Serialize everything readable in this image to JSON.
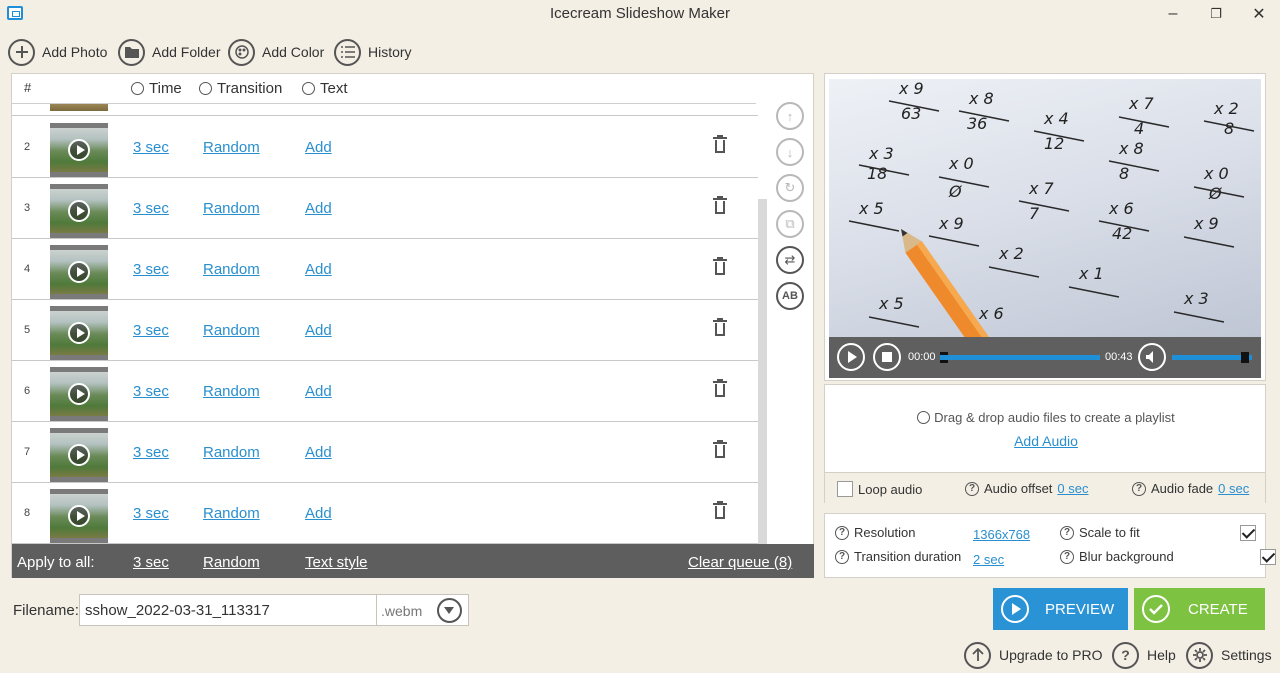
{
  "window": {
    "title": "Icecream Slideshow Maker",
    "minimize": "–",
    "maximize": "❐",
    "close": "✕"
  },
  "toolbar": {
    "add_photo": "Add Photo",
    "add_folder": "Add Folder",
    "add_color": "Add Color",
    "history": "History"
  },
  "list": {
    "headers": {
      "num": "#",
      "time": "Time",
      "transition": "Transition",
      "text": "Text"
    },
    "rows": [
      {
        "num": "2",
        "time": "3 sec",
        "transition": "Random",
        "text": "Add"
      },
      {
        "num": "3",
        "time": "3 sec",
        "transition": "Random",
        "text": "Add"
      },
      {
        "num": "4",
        "time": "3 sec",
        "transition": "Random",
        "text": "Add"
      },
      {
        "num": "5",
        "time": "3 sec",
        "transition": "Random",
        "text": "Add"
      },
      {
        "num": "6",
        "time": "3 sec",
        "transition": "Random",
        "text": "Add"
      },
      {
        "num": "7",
        "time": "3 sec",
        "transition": "Random",
        "text": "Add"
      },
      {
        "num": "8",
        "time": "3 sec",
        "transition": "Random",
        "text": "Add"
      }
    ]
  },
  "side_actions": {
    "up": "↑",
    "down": "↓",
    "rotate": "↻",
    "duplicate": "⧉",
    "shuffle": "⇄",
    "ab": "AB"
  },
  "apply_all": {
    "label": "Apply to all:",
    "time": "3 sec",
    "transition": "Random",
    "text_style": "Text style",
    "clear_queue": "Clear queue (8)"
  },
  "output": {
    "filename_label": "Filename:",
    "filename": "sshow_2022-03-31_113317",
    "extension": ".webm"
  },
  "player": {
    "current": "00:00",
    "total": "00:43",
    "progress": 0.0,
    "volume": 1.0
  },
  "audio": {
    "drop_hint": "Drag & drop audio files to create a playlist",
    "add_audio": "Add Audio",
    "loop_label": "Loop audio",
    "loop_checked": false,
    "offset_label": "Audio offset",
    "offset_value": "0 sec",
    "fade_label": "Audio fade",
    "fade_value": "0 sec"
  },
  "settings": {
    "resolution_label": "Resolution",
    "resolution_value": "1366x768",
    "duration_label": "Transition duration",
    "duration_value": "2 sec",
    "scale_label": "Scale to fit",
    "scale_checked": true,
    "blur_label": "Blur background",
    "blur_checked": true
  },
  "actions": {
    "preview": "PREVIEW",
    "create": "CREATE"
  },
  "footer": {
    "upgrade": "Upgrade to PRO",
    "help": "Help",
    "settings": "Settings"
  },
  "colors": {
    "accent_blue": "#2a93d5",
    "create_green": "#7dc241",
    "link": "#2a8fcf",
    "background": "#f3efe5"
  }
}
